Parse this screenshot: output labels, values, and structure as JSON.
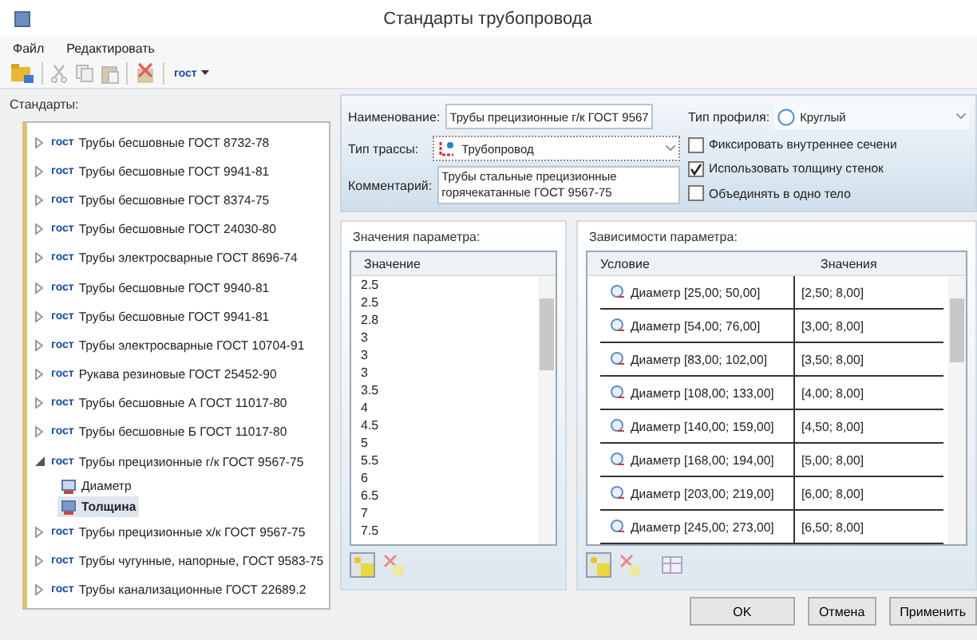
{
  "window": {
    "title": "Стандарты трубопровода"
  },
  "menu": [
    "Файл",
    "Редактировать"
  ],
  "toolbar": {
    "filter_label": "гост"
  },
  "standards": {
    "label": "Стандарты:",
    "items": [
      {
        "badge": "гост",
        "label": "Трубы бесшовные ГОСТ 8732-78",
        "expanded": false
      },
      {
        "badge": "гост",
        "label": "Трубы бесшовные ГОСТ 9941-81",
        "expanded": false
      },
      {
        "badge": "гост",
        "label": "Трубы бесшовные ГОСТ 8374-75",
        "expanded": false
      },
      {
        "badge": "гост",
        "label": "Трубы бесшовные ГОСТ 24030-80",
        "expanded": false
      },
      {
        "badge": "гост",
        "label": "Трубы электросварные ГОСТ 8696-74",
        "expanded": false
      },
      {
        "badge": "гост",
        "label": "Трубы бесшовные ГОСТ 9940-81",
        "expanded": false
      },
      {
        "badge": "гост",
        "label": "Трубы бесшовные ГОСТ 9941-81",
        "expanded": false
      },
      {
        "badge": "гост",
        "label": "Трубы электросварные ГОСТ 10704-91",
        "expanded": false
      },
      {
        "badge": "гост",
        "label": "Рукава резиновые ГОСТ 25452-90",
        "expanded": false
      },
      {
        "badge": "гост",
        "label": "Трубы бесшовные А ГОСТ 11017-80",
        "expanded": false
      },
      {
        "badge": "гост",
        "label": "Трубы бесшовные Б ГОСТ 11017-80",
        "expanded": false
      },
      {
        "badge": "гост",
        "label": "Трубы прецизионные г/к ГОСТ 9567-75",
        "expanded": true,
        "children": [
          {
            "label": "Диаметр",
            "selected": false
          },
          {
            "label": "Толщина",
            "selected": true
          }
        ]
      },
      {
        "badge": "гост",
        "label": "Трубы прецизионные х/к ГОСТ 9567-75",
        "expanded": false
      },
      {
        "badge": "гост",
        "label": "Трубы чугунные, напорные, ГОСТ 9583-75",
        "expanded": false
      },
      {
        "badge": "гост",
        "label": "Трубы канализационные ГОСТ 22689.2",
        "expanded": false
      }
    ]
  },
  "form": {
    "name_label": "Наименование:",
    "name_value": "Трубы прецизионные г/к ГОСТ 9567",
    "profile_label": "Тип профиля:",
    "profile_value": "Круглый",
    "route_label": "Тип трассы:",
    "route_value": "Трубопровод",
    "comment_label": "Комментарий:",
    "comment_value": "Трубы стальные прецизионные горячекатанные ГОСТ 9567-75",
    "options": [
      {
        "label": "Фиксировать внутреннее сечени",
        "checked": false
      },
      {
        "label": "Использовать толщину стенок",
        "checked": true
      },
      {
        "label": "Объединять в одно тело",
        "checked": false
      }
    ]
  },
  "values": {
    "label": "Значения параметра:",
    "column": "Значение",
    "rows": [
      "2.5",
      "2.5",
      "2.8",
      "3",
      "3",
      "3",
      "3.5",
      "4",
      "4.5",
      "5",
      "5.5",
      "6",
      "6.5",
      "7",
      "7.5"
    ]
  },
  "dependencies": {
    "label": "Зависимости параметра:",
    "columns": [
      "Условие",
      "Значения"
    ],
    "rows": [
      {
        "condition": "Диаметр [25,00; 50,00]",
        "value": "[2,50; 8,00]"
      },
      {
        "condition": "Диаметр [54,00; 76,00]",
        "value": "[3,00; 8,00]"
      },
      {
        "condition": "Диаметр [83,00; 102,00]",
        "value": "[3,50; 8,00]"
      },
      {
        "condition": "Диаметр [108,00; 133,00]",
        "value": "[4,00; 8,00]"
      },
      {
        "condition": "Диаметр [140,00; 159,00]",
        "value": "[4,50; 8,00]"
      },
      {
        "condition": "Диаметр [168,00; 194,00]",
        "value": "[5,00; 8,00]"
      },
      {
        "condition": "Диаметр [203,00; 219,00]",
        "value": "[6,00; 8,00]"
      },
      {
        "condition": "Диаметр [245,00; 273,00]",
        "value": "[6,50; 8,00]"
      }
    ]
  },
  "buttons": [
    "OK",
    "Отмена",
    "Применить"
  ]
}
